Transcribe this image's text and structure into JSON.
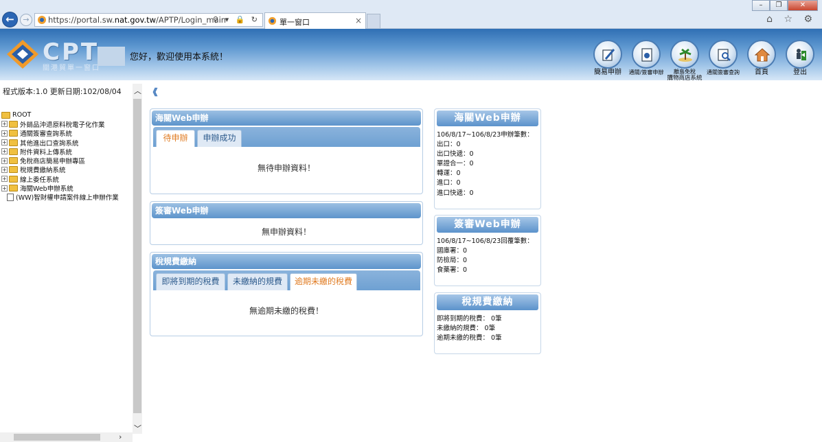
{
  "browser": {
    "url_prefix": "https://portal.sw.",
    "url_domain": "nat.gov.tw",
    "url_path": "/APTP/Login_main",
    "addr_tools": "⚲ ▾ 🔒 ↻",
    "tab_title": "單一窗口",
    "tab_close": "×",
    "min": "–",
    "max": "❐",
    "close": "✕",
    "icons": "⌂ ☆ ⚙",
    "back": "←",
    "forward": "→"
  },
  "header": {
    "logo_text": "CPT",
    "logo_sub": "關港貿單一窗口",
    "welcome": "您好，歡迎使用本系統！",
    "buttons": [
      {
        "label": "簡易申辦",
        "icon": "pen-icon"
      },
      {
        "label": "通關/簽審申辦",
        "icon": "document-icon"
      },
      {
        "label": "購物商店系統",
        "sub": "離島免稅",
        "icon": "island-icon"
      },
      {
        "label": "通關簽審查詢",
        "icon": "search-doc-icon"
      },
      {
        "label": "首頁",
        "icon": "home-icon"
      },
      {
        "label": "登出",
        "icon": "logout-icon"
      }
    ]
  },
  "sidebar": {
    "version": "程式版本:1.0 更新日期:102/08/04",
    "root": "ROOT",
    "items": [
      "外銷品沖退原料稅電子化作業",
      "通關簽審查詢系統",
      "其他進出口查詢系統",
      "附件資料上傳系統",
      "免稅商店簡易申辦專區",
      "稅規費繳納系統",
      "線上委任系統",
      "海關Web申辦系統"
    ],
    "doc_item": "(WW)智財權申請案件線上申辦作業"
  },
  "main": {
    "customs_panel": {
      "title": "海關Web申辦",
      "tabs": [
        "待申辦",
        "申辦成功"
      ],
      "message": "無待申辦資料！"
    },
    "visa_panel": {
      "title": "簽審Web申辦",
      "message": "無申辦資料！"
    },
    "fee_panel": {
      "title": "稅規費繳納",
      "tabs": [
        "即將到期的稅費",
        "未繳納的規費",
        "逾期未繳的稅費"
      ],
      "message": "無逾期未繳的稅費！"
    }
  },
  "side": {
    "customs": {
      "title": "海關Web申辦",
      "lines": [
        "106/8/17~106/8/23申辦筆數：",
        "出口：0",
        "出口快遞：0",
        "單證合一：0",
        "轉運：0",
        "進口：0",
        "進口快遞：0"
      ]
    },
    "visa": {
      "title": "簽審Web申辦",
      "lines": [
        "106/8/17~106/8/23回覆筆數：",
        "國庫署：0",
        "防檢局：0",
        "食藥署：0"
      ]
    },
    "fee": {
      "title": "稅規費繳納",
      "lines": [
        "即將到期的稅費： 0筆",
        "未繳納的規費： 0筆",
        "逾期未繳的稅費： 0筆"
      ]
    }
  },
  "colors": {
    "accent": "#5d94cb",
    "active_tab": "#e07b21",
    "header_top": "#2f6fb4"
  }
}
